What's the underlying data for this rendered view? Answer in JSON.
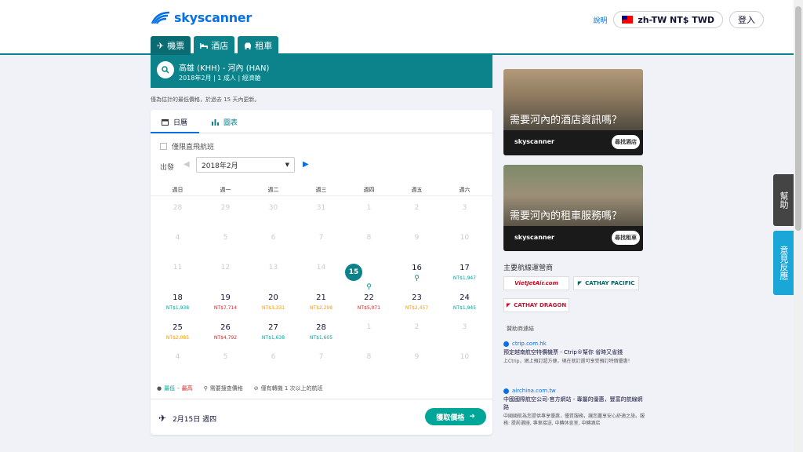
{
  "header": {
    "logo_text": "skyscanner",
    "help": "說明",
    "locale": "zh-TW NT$ TWD",
    "login": "登入"
  },
  "tabs": [
    {
      "label": "機票",
      "icon": "plane-icon"
    },
    {
      "label": "酒店",
      "icon": "bed-icon"
    },
    {
      "label": "租車",
      "icon": "car-icon"
    }
  ],
  "search": {
    "route": "高雄 (KHH) - 河內 (HAN)",
    "month": "2018年2月",
    "adults": "1 成人",
    "cabin": "經濟艙"
  },
  "notice": "僅為估計的最低價格，於過去 15 天內更新。",
  "calendar": {
    "tab_calendar": "日曆",
    "tab_chart": "圖表",
    "direct_only": "僅限直飛航班",
    "depart_label": "出發",
    "month_select": "2018年2月",
    "weekdays": [
      "週日",
      "週一",
      "週二",
      "週三",
      "週四",
      "週五",
      "週六"
    ],
    "rows": [
      [
        {
          "d": "28",
          "m": true
        },
        {
          "d": "29",
          "m": true
        },
        {
          "d": "30",
          "m": true
        },
        {
          "d": "31",
          "m": true
        },
        {
          "d": "1",
          "m": true
        },
        {
          "d": "2",
          "m": true
        },
        {
          "d": "3",
          "m": true
        }
      ],
      [
        {
          "d": "4",
          "m": true
        },
        {
          "d": "5",
          "m": true
        },
        {
          "d": "6",
          "m": true
        },
        {
          "d": "7",
          "m": true
        },
        {
          "d": "8",
          "m": true
        },
        {
          "d": "9",
          "m": true
        },
        {
          "d": "10",
          "m": true
        }
      ],
      [
        {
          "d": "11",
          "m": true
        },
        {
          "d": "12",
          "m": true
        },
        {
          "d": "13",
          "m": true
        },
        {
          "d": "14",
          "m": true
        },
        {
          "d": "15",
          "sel": true,
          "search": true
        },
        {
          "d": "16",
          "search": true
        },
        {
          "d": "17",
          "p": "NT$1,947",
          "c": "green"
        }
      ],
      [
        {
          "d": "18",
          "p": "NT$1,938",
          "c": "green"
        },
        {
          "d": "19",
          "p": "NT$7,714",
          "c": "red"
        },
        {
          "d": "20",
          "p": "NT$3,331",
          "c": "orange"
        },
        {
          "d": "21",
          "p": "NT$2,298",
          "c": "orange"
        },
        {
          "d": "22",
          "p": "NT$5,071",
          "c": "red"
        },
        {
          "d": "23",
          "p": "NT$2,457",
          "c": "orange"
        },
        {
          "d": "24",
          "p": "NT$1,945",
          "c": "green"
        }
      ],
      [
        {
          "d": "25",
          "p": "NT$2,085",
          "c": "orange"
        },
        {
          "d": "26",
          "p": "NT$4,792",
          "c": "red"
        },
        {
          "d": "27",
          "p": "NT$1,638",
          "c": "green"
        },
        {
          "d": "28",
          "p": "NT$1,605",
          "c": "green"
        },
        {
          "d": "1",
          "m": true
        },
        {
          "d": "2",
          "m": true
        },
        {
          "d": "3",
          "m": true
        }
      ],
      [
        {
          "d": "4",
          "m": true
        },
        {
          "d": "5",
          "m": true
        },
        {
          "d": "6",
          "m": true
        },
        {
          "d": "7",
          "m": true
        },
        {
          "d": "8",
          "m": true
        },
        {
          "d": "9",
          "m": true
        },
        {
          "d": "10",
          "m": true
        }
      ]
    ],
    "legend_cheap": "最低",
    "legend_sep": " - ",
    "legend_expensive": "最高",
    "legend_search": "需要搜查價格",
    "legend_note": "僅有轉機 1 次以上的航班",
    "selected_date": "2月15日 週四",
    "get_price": "獲取價格"
  },
  "promos": [
    {
      "title": "需要河內的酒店資訊嗎？",
      "logo": "skyscanner",
      "button": "尋找酒店"
    },
    {
      "title": "需要河內的租車服務嗎？",
      "logo": "skyscanner",
      "button": "尋找租車"
    }
  ],
  "airlines": {
    "title": "主要航線運營商",
    "items": [
      "VietJetAir.com",
      "CATHAY PACIFIC",
      "CATHAY DRAGON"
    ]
  },
  "sponsors": {
    "title": "贊助商連結",
    "items": [
      {
        "src": "ctrip.com.hk",
        "head": "預定越南航空特價機票 - Ctrip®幫你 省時又省錢",
        "desc": "上Ctrip，網上預訂超方便，現在就訂還可享受預訂特價優惠！"
      },
      {
        "src": "airchina.com.tw",
        "head": "中國國際航空公司-官方網站 - 專屬的優惠，豐富的航線網路",
        "desc": "中國國航為您提供專享優惠，優質服務，讓您盡享安心舒適之旅。服務: 提前選座, 專車接送, 中轉休息室, 中轉酒店"
      }
    ]
  },
  "side": {
    "help": "幫助",
    "feedback": "意見反應"
  },
  "colors": {
    "teal": "#0c838a",
    "green": "#00a698",
    "orange": "#ff9800",
    "red": "#e02020",
    "blue": "#0770e3"
  }
}
